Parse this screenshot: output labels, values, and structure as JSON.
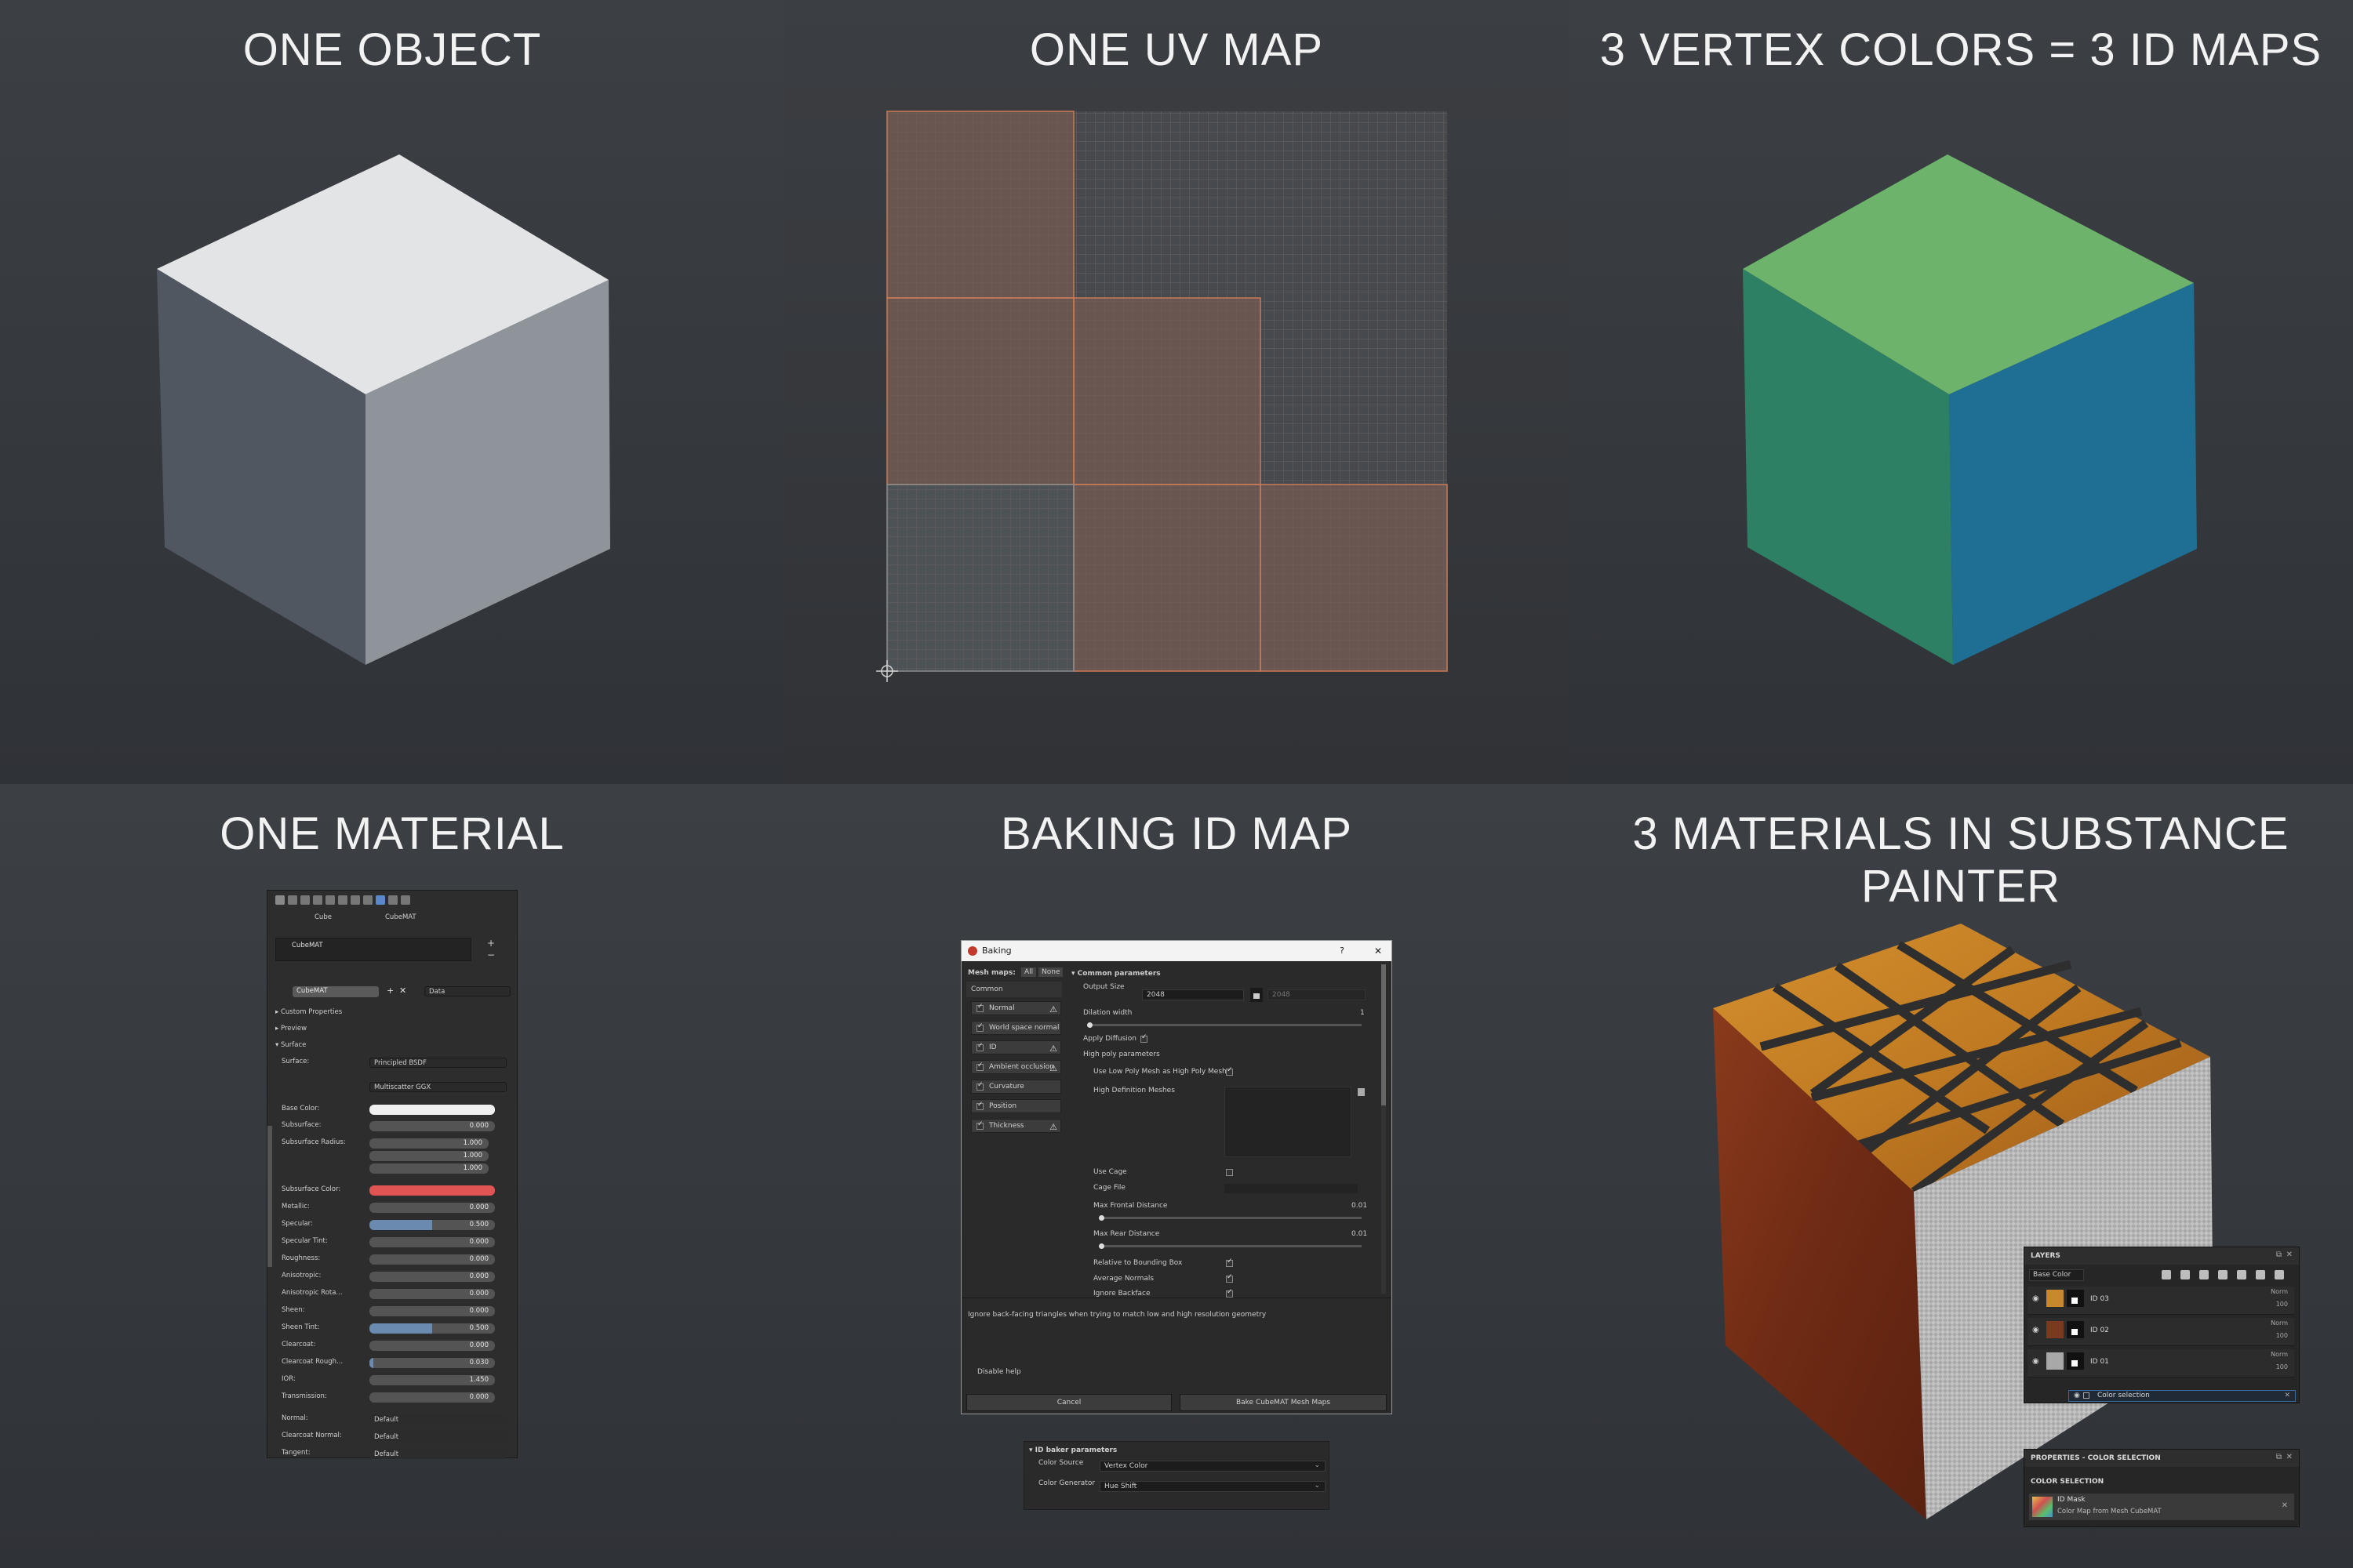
{
  "panels": {
    "one_object": {
      "title": "ONE OBJECT"
    },
    "one_uv_map": {
      "title": "ONE UV MAP"
    },
    "vertex_colors": {
      "title": "3 VERTEX COLORS = 3 ID MAPS"
    },
    "one_material": {
      "title": "ONE MATERIAL"
    },
    "baking": {
      "title": "BAKING ID MAP"
    },
    "substance": {
      "title": "3 MATERIALS IN SUBSTANCE PAINTER"
    }
  },
  "colors": {
    "cube_top": "#e3e4e5",
    "cube_left": "#505761",
    "cube_right": "#8e9499",
    "id_top": "#6db36b",
    "id_left": "#2e8065",
    "id_right": "#1f6f94",
    "uv_island": "#6a5650",
    "uv_grid": "#4f5357",
    "subsurface_color": "#e05454",
    "base_color": "#f0f0f0"
  },
  "blender": {
    "tabs": {
      "object": "Cube",
      "material": "CubeMAT"
    },
    "slot_name": "CubeMAT",
    "material_name": "CubeMAT",
    "data_label": "Data",
    "sections": {
      "custom_properties": "Custom Properties",
      "preview": "Preview",
      "surface_section": "Surface"
    },
    "surface": {
      "label": "Surface:",
      "value": "Principled BSDF"
    },
    "distribution": "Multiscatter GGX",
    "base_color_label": "Base Color:",
    "subsurface": {
      "label": "Subsurface:",
      "value": "0.000"
    },
    "subsurface_radius": {
      "label": "Subsurface Radius:",
      "values": [
        "1.000",
        "1.000",
        "1.000"
      ]
    },
    "subsurface_color_label": "Subsurface Color:",
    "props": [
      {
        "label": "Metallic:",
        "value": "0.000",
        "fill": 0.0
      },
      {
        "label": "Specular:",
        "value": "0.500",
        "fill": 0.5
      },
      {
        "label": "Specular Tint:",
        "value": "0.000",
        "fill": 0.0
      },
      {
        "label": "Roughness:",
        "value": "0.000",
        "fill": 0.0
      },
      {
        "label": "Anisotropic:",
        "value": "0.000",
        "fill": 0.0
      },
      {
        "label": "Anisotropic Rota...",
        "value": "0.000",
        "fill": 0.0
      },
      {
        "label": "Sheen:",
        "value": "0.000",
        "fill": 0.0
      },
      {
        "label": "Sheen Tint:",
        "value": "0.500",
        "fill": 0.5
      },
      {
        "label": "Clearcoat:",
        "value": "0.000",
        "fill": 0.0
      },
      {
        "label": "Clearcoat Rough...",
        "value": "0.030",
        "fill": 0.03
      },
      {
        "label": "IOR:",
        "value": "1.450",
        "fill": 0.0
      },
      {
        "label": "Transmission:",
        "value": "0.000",
        "fill": 0.0
      }
    ],
    "defaults": [
      {
        "label": "Normal:",
        "value": "Default"
      },
      {
        "label": "Clearcoat Normal:",
        "value": "Default"
      },
      {
        "label": "Tangent:",
        "value": "Default"
      }
    ]
  },
  "baking_dialog": {
    "title": "Baking",
    "help": "?",
    "mesh_maps_label": "Mesh maps:",
    "all_label": "All",
    "none_label": "None",
    "common_label": "Common",
    "maps": [
      {
        "label": "Normal",
        "warn": true
      },
      {
        "label": "World space normal",
        "warn": false
      },
      {
        "label": "ID",
        "warn": true
      },
      {
        "label": "Ambient occlusion",
        "warn": true
      },
      {
        "label": "Curvature",
        "warn": false
      },
      {
        "label": "Position",
        "warn": false
      },
      {
        "label": "Thickness",
        "warn": true
      }
    ],
    "common_parameters": "Common parameters",
    "output_size_label": "Output Size",
    "output_size": "2048",
    "output_size_2": "2048",
    "dilation_label": "Dilation width",
    "dilation_value": "1",
    "apply_diffusion": "Apply Diffusion",
    "high_poly_params": "High poly parameters",
    "use_low_poly": "Use Low Poly Mesh as High Poly Mesh",
    "hd_meshes": "High Definition Meshes",
    "use_cage": "Use Cage",
    "cage_file": "Cage File",
    "max_frontal_label": "Max Frontal Distance",
    "max_frontal_value": "0.01",
    "max_rear_label": "Max Rear Distance",
    "max_rear_value": "0.01",
    "relative_bbox": "Relative to Bounding Box",
    "average_normals": "Average Normals",
    "ignore_backface": "Ignore Backface",
    "description": "Ignore back-facing triangles when trying to match low and high resolution geometry",
    "disable_help": "Disable help",
    "cancel": "Cancel",
    "bake_button": "Bake CubeMAT Mesh Maps"
  },
  "id_baker": {
    "title": "ID baker parameters",
    "color_source_label": "Color Source",
    "color_source_value": "Vertex Color",
    "color_generator_label": "Color Generator",
    "color_generator_value": "Hue Shift"
  },
  "layers_panel": {
    "title": "LAYERS",
    "channel": "Base Color",
    "layers": [
      {
        "name": "ID 03",
        "blend": "Norm",
        "opacity": "100",
        "swatch": "#c8892e"
      },
      {
        "name": "ID 02",
        "blend": "Norm",
        "opacity": "100",
        "swatch": "#7a3a1e"
      },
      {
        "name": "ID 01",
        "blend": "Norm",
        "opacity": "100",
        "swatch": "#a8a8a8"
      }
    ],
    "sub_layer": "Color selection"
  },
  "properties_panel": {
    "title": "PROPERTIES - COLOR SELECTION",
    "section": "COLOR SELECTION",
    "id_mask": "ID Mask",
    "id_mask_sub": "Color Map from Mesh CubeMAT"
  }
}
